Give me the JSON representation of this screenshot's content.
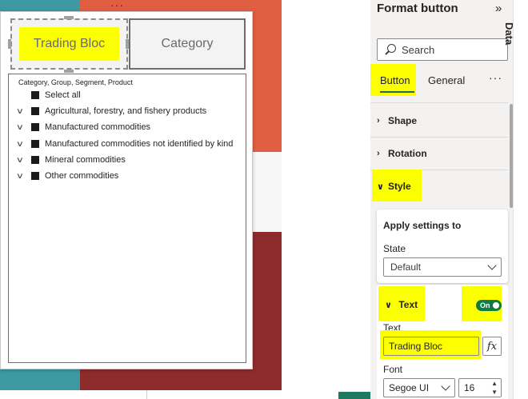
{
  "canvas": {
    "visual": {
      "more_label": "···",
      "buttons": {
        "trading_bloc": "Trading Bloc",
        "category": "Category"
      },
      "slicer": {
        "header": "Category, Group, Segment, Product",
        "items": [
          {
            "label": "Select all",
            "expandable": false
          },
          {
            "label": "Agricultural, forestry, and fishery products",
            "expandable": true
          },
          {
            "label": "Manufactured commodities",
            "expandable": true
          },
          {
            "label": "Manufactured commodities not identified by kind",
            "expandable": true
          },
          {
            "label": "Mineral commodities",
            "expandable": true
          },
          {
            "label": "Other commodities",
            "expandable": true
          }
        ]
      }
    },
    "colors": {
      "teal": "#3d9aa2",
      "orange": "#e05f43",
      "red": "#8e2b2b",
      "highlight": "#fbff00"
    }
  },
  "format_pane": {
    "title": "Format button",
    "collapse_icon": "double-chevron-right-icon",
    "search_placeholder": "Search",
    "tabs": {
      "button": "Button",
      "general": "General",
      "more": "···"
    },
    "sections": {
      "shape": "Shape",
      "rotation": "Rotation",
      "style": "Style"
    },
    "apply_settings": {
      "title": "Apply settings to",
      "state_label": "State",
      "state_value": "Default"
    },
    "text": {
      "section_label": "Text",
      "toggle_label": "On",
      "text_label": "Text",
      "text_value": "Trading Bloc",
      "fx_label": "fx",
      "font_label": "Font",
      "font_value": "Segoe UI",
      "font_size": "16"
    }
  },
  "data_pane": {
    "label": "Data"
  }
}
